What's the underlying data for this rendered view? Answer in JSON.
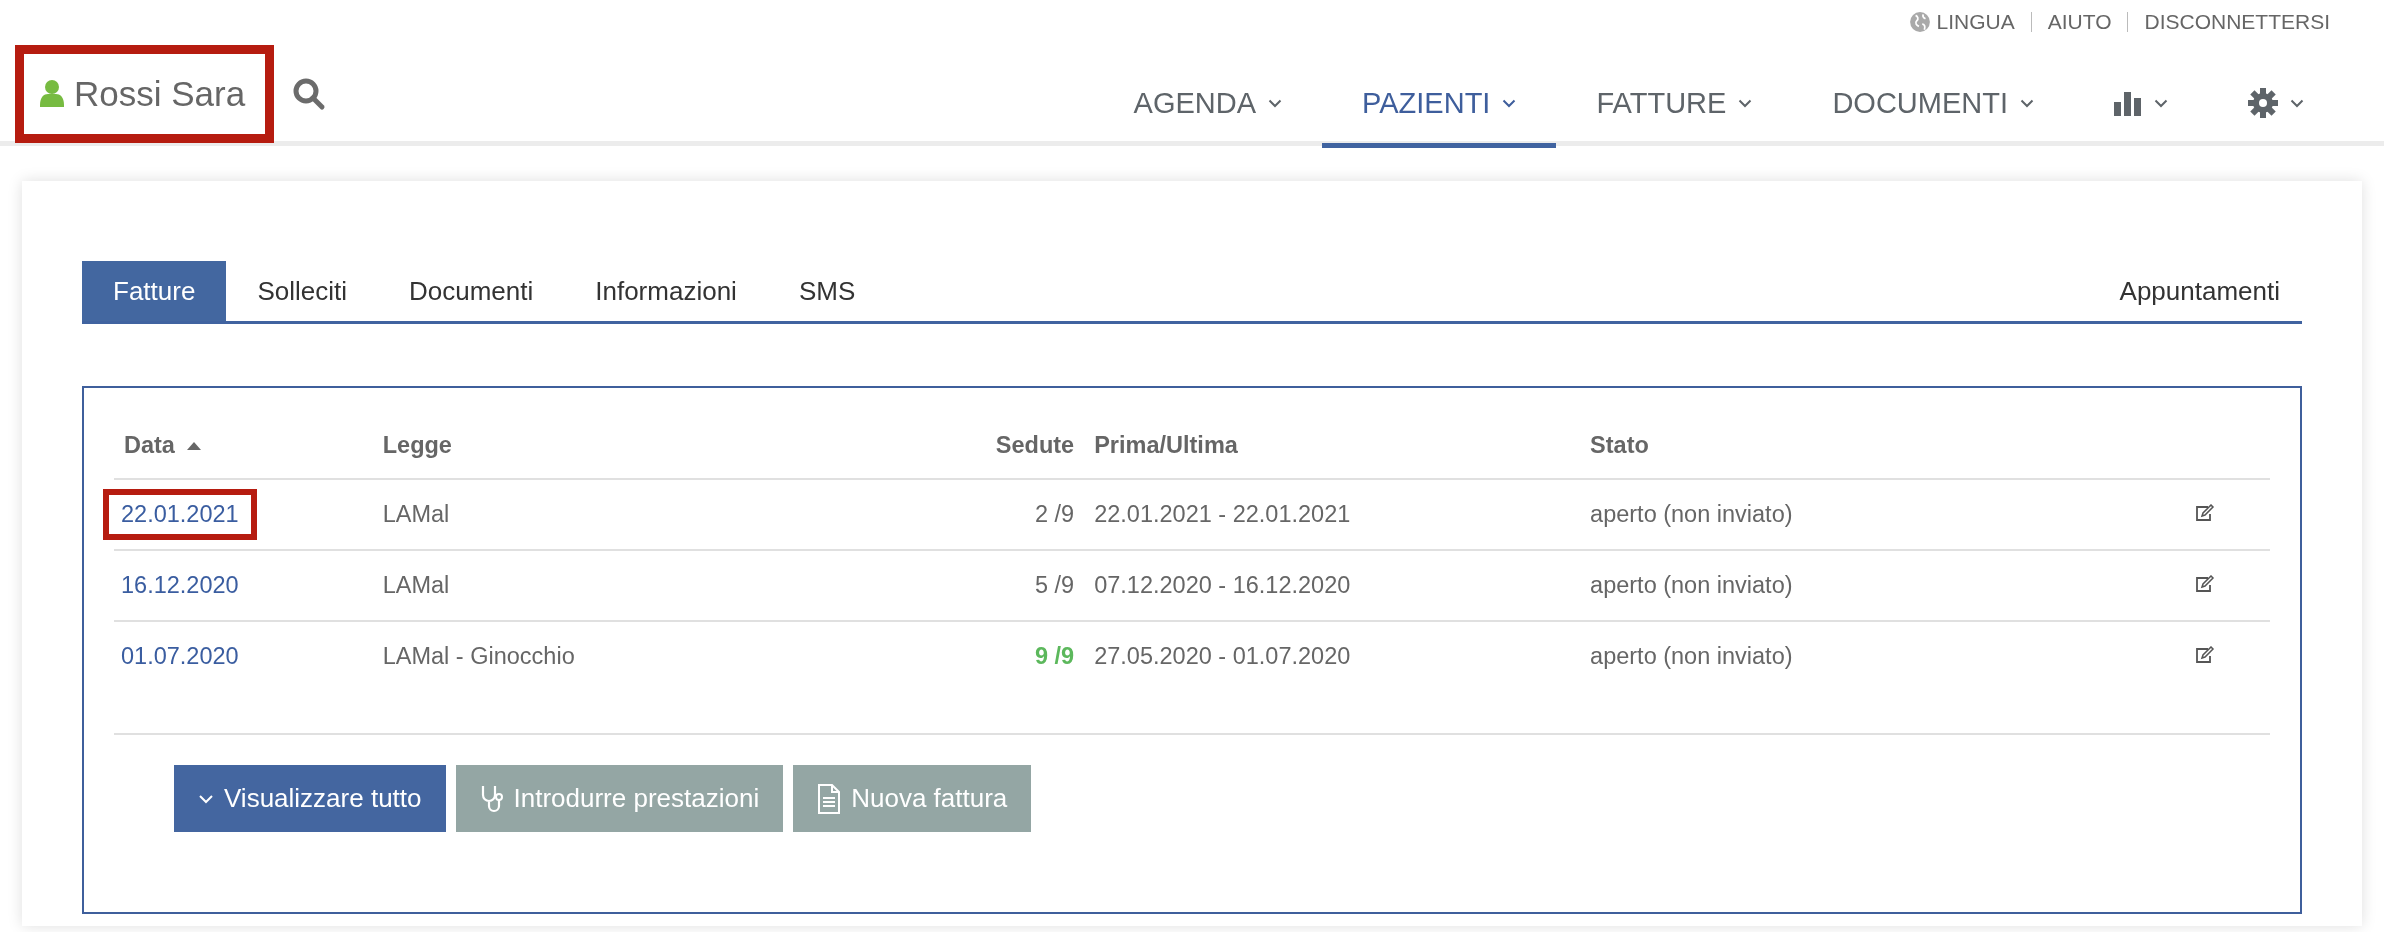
{
  "utility_links": [
    {
      "label": "LINGUA"
    },
    {
      "label": "AIUTO"
    },
    {
      "label": "DISCONNETTERSI"
    }
  ],
  "patient": {
    "name": "Rossi Sara",
    "highlighted": true
  },
  "nav": [
    {
      "kind": "text",
      "label": "AGENDA",
      "selected": false
    },
    {
      "kind": "text",
      "label": "PAZIENTI",
      "selected": true
    },
    {
      "kind": "text",
      "label": "FATTURE",
      "selected": false
    },
    {
      "kind": "text",
      "label": "DOCUMENTI",
      "selected": false
    },
    {
      "kind": "chart",
      "selected": false
    },
    {
      "kind": "settings",
      "selected": false
    }
  ],
  "tabs": [
    {
      "label": "Fatture",
      "selected": true
    },
    {
      "label": "Solleciti",
      "selected": false
    },
    {
      "label": "Documenti",
      "selected": false
    },
    {
      "label": "Informazioni",
      "selected": false
    },
    {
      "label": "SMS",
      "selected": false
    },
    {
      "label": "Appuntamenti",
      "selected": false
    }
  ],
  "table": {
    "columns": [
      {
        "label": "Data",
        "sorted": true
      },
      {
        "label": "Legge",
        "sorted": false
      },
      {
        "label": "Sedute",
        "sorted": false
      },
      {
        "label": "Prima/Ultima",
        "sorted": false
      },
      {
        "label": "Stato",
        "sorted": false
      }
    ],
    "rows": [
      {
        "date": "22.01.2021",
        "highlighted": true,
        "law": "LAMal",
        "sessions": "2 /9",
        "complete": false,
        "period": "22.01.2021 - 22.01.2021",
        "status": "aperto (non inviato)"
      },
      {
        "date": "16.12.2020",
        "highlighted": false,
        "law": "LAMal",
        "sessions": "5 /9",
        "complete": false,
        "period": "07.12.2020 - 16.12.2020",
        "status": "aperto (non inviato)"
      },
      {
        "date": "01.07.2020",
        "highlighted": false,
        "law": "LAMal - Ginocchio",
        "sessions": "9 /9",
        "complete": true,
        "period": "27.05.2020 - 01.07.2020",
        "status": "aperto (non inviato)"
      }
    ]
  },
  "buttons": [
    {
      "label": "Visualizzare tutto",
      "kind": "primary"
    },
    {
      "label": "Introdurre prestazioni",
      "kind": "secondary"
    },
    {
      "label": "Nuova fattura",
      "kind": "secondary"
    }
  ]
}
